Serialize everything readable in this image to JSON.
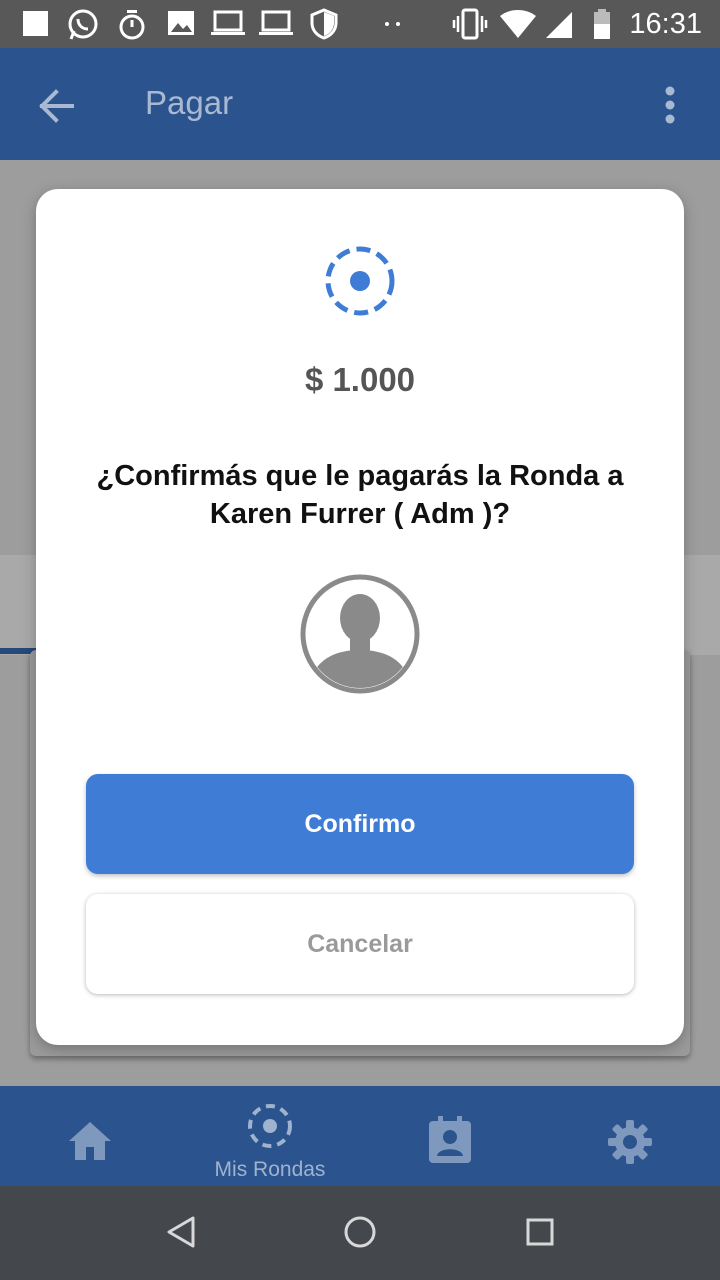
{
  "status_bar": {
    "time": "16:31",
    "icons": [
      "notification-square-icon",
      "whatsapp-icon",
      "stopwatch-icon",
      "image-icon",
      "laptop-icon",
      "laptop-icon",
      "shield-icon",
      "more-dots-icon",
      "vibrate-icon",
      "wifi-icon",
      "signal-icon",
      "battery-icon"
    ]
  },
  "app_bar": {
    "title": "Pagar",
    "back_icon": "arrow-back-icon",
    "menu_icon": "more-vert-icon"
  },
  "dialog": {
    "amount": "$ 1.000",
    "question": "¿Confirmás que le pagarás la Ronda a Karen Furrer ( Adm )?",
    "confirm_label": "Confirmo",
    "cancel_label": "Cancelar",
    "accent_color": "#3e7cd6"
  },
  "bottom_nav": {
    "items": [
      {
        "icon": "home-icon",
        "label": ""
      },
      {
        "icon": "ronda-icon",
        "label": "Mis Rondas"
      },
      {
        "icon": "contact-calendar-icon",
        "label": ""
      },
      {
        "icon": "gear-icon",
        "label": ""
      }
    ]
  },
  "system_nav": {
    "icons": [
      "back-triangle-icon",
      "home-circle-icon",
      "recents-square-icon"
    ]
  }
}
